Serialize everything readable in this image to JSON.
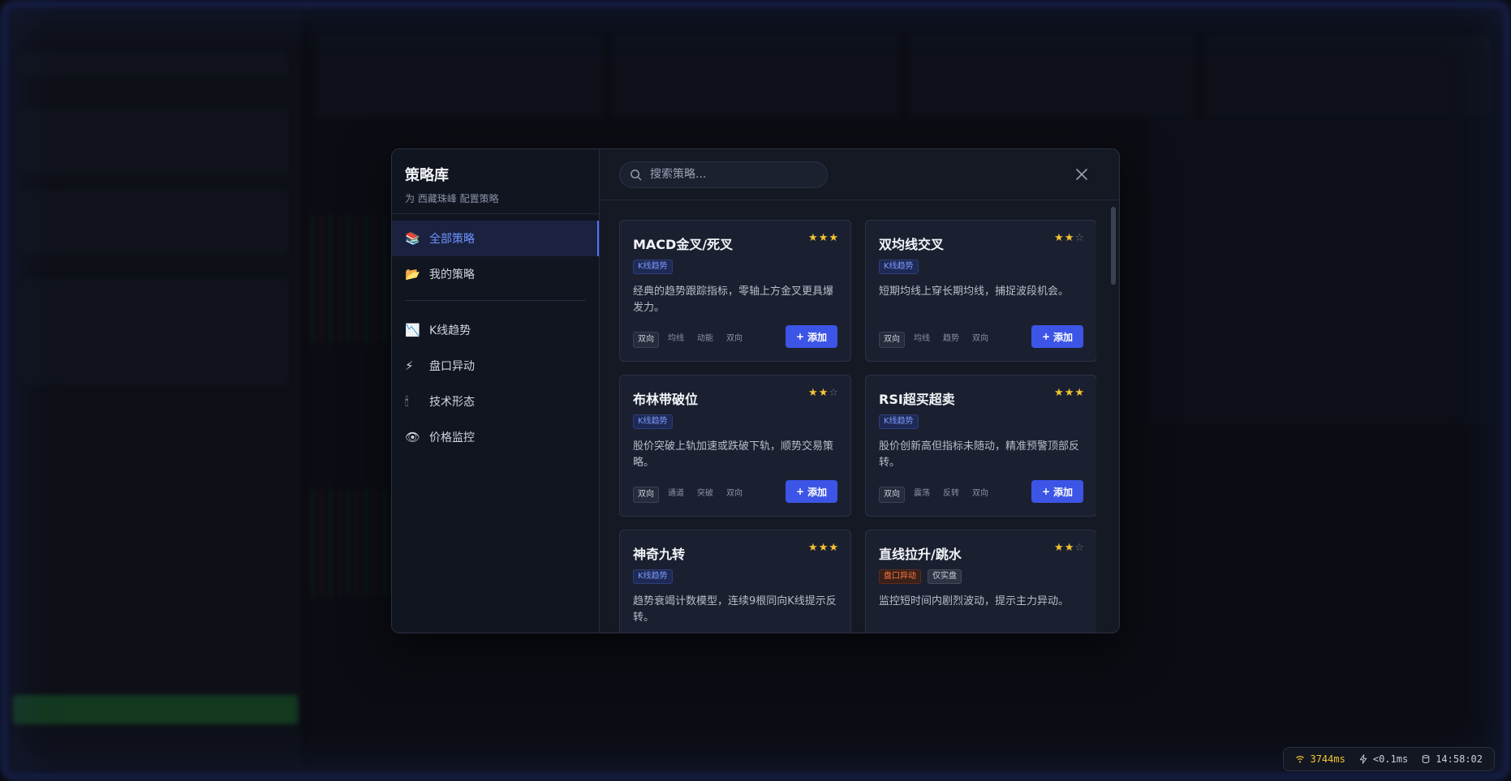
{
  "modal": {
    "title": "策略库",
    "subtitle": "为 西藏珠峰 配置策略",
    "search_placeholder": "搜索策略...",
    "nav": [
      {
        "icon": "📚",
        "label": "全部策略",
        "active": true
      },
      {
        "icon": "📂",
        "label": "我的策略"
      },
      {
        "icon": "📉",
        "label": "K线趋势"
      },
      {
        "icon": "⚡",
        "label": "盘口异动"
      },
      {
        "icon": "🕯",
        "label": "技术形态"
      },
      {
        "icon": "👁",
        "label": "价格监控"
      }
    ],
    "add_label": "添加",
    "cards": [
      {
        "title": "MACD金叉/死叉",
        "rating": 3,
        "badges": [
          "K线趋势"
        ],
        "desc": "经典的趋势跟踪指标，零轴上方金叉更具爆发力。",
        "tags": [
          "双向",
          "均线",
          "动能",
          "双向"
        ]
      },
      {
        "title": "双均线交叉",
        "rating": 2,
        "badges": [
          "K线趋势"
        ],
        "desc": "短期均线上穿长期均线，捕捉波段机会。",
        "tags": [
          "双向",
          "均线",
          "趋势",
          "双向"
        ]
      },
      {
        "title": "布林带破位",
        "rating": 2,
        "badges": [
          "K线趋势"
        ],
        "desc": "股价突破上轨加速或跌破下轨，顺势交易策略。",
        "tags": [
          "双向",
          "通道",
          "突破",
          "双向"
        ]
      },
      {
        "title": "RSI超买超卖",
        "rating": 3,
        "badges": [
          "K线趋势"
        ],
        "desc": "股价创新高但指标未随动，精准预警顶部反转。",
        "tags": [
          "双向",
          "震荡",
          "反转",
          "双向"
        ]
      },
      {
        "title": "神奇九转",
        "rating": 3,
        "badges": [
          "K线趋势"
        ],
        "desc": "趋势衰竭计数模型，连续9根同向K线提示反转。",
        "tags": []
      },
      {
        "title": "直线拉升/跳水",
        "rating": 2,
        "badges": [
          "盘口异动",
          "仅实盘"
        ],
        "desc": "监控短时间内剧烈波动，提示主力异动。",
        "tags": []
      }
    ]
  },
  "status": {
    "latency": "3744ms",
    "compute": "<0.1ms",
    "clock": "14:58:02"
  },
  "colors": {
    "accent": "#3c55e6",
    "star": "#f4c430",
    "nav_active": "#6f93ff"
  }
}
